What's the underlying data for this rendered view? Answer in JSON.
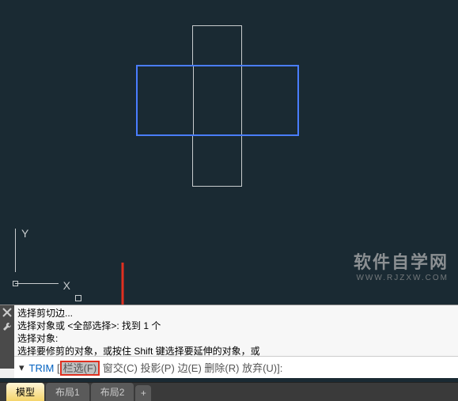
{
  "ucs": {
    "x_label": "X",
    "y_label": "Y"
  },
  "watermark": {
    "main": "软件自学网",
    "sub": "WWW.RJZXW.COM"
  },
  "command_history": {
    "line1": "选择剪切边...",
    "line2": "选择对象或 <全部选择>:   找到 1 个",
    "line3": "选择对象:",
    "line4": "选择要修剪的对象，或按住 Shift 键选择要延伸的对象，或"
  },
  "command_input": {
    "prompt_caret": "▾",
    "command": "TRIM",
    "bracket_open": "[",
    "opt_fence": "栏选(F)",
    "opt_crossing": "窗交(C)",
    "opt_project": "投影(P)",
    "opt_edge": "边(E)",
    "opt_erase": "删除(R)",
    "opt_undo": "放弃(U)",
    "bracket_close": "]:"
  },
  "tabs": {
    "model": "模型",
    "layout1": "布局1",
    "layout2": "布局2",
    "plus": "+"
  }
}
